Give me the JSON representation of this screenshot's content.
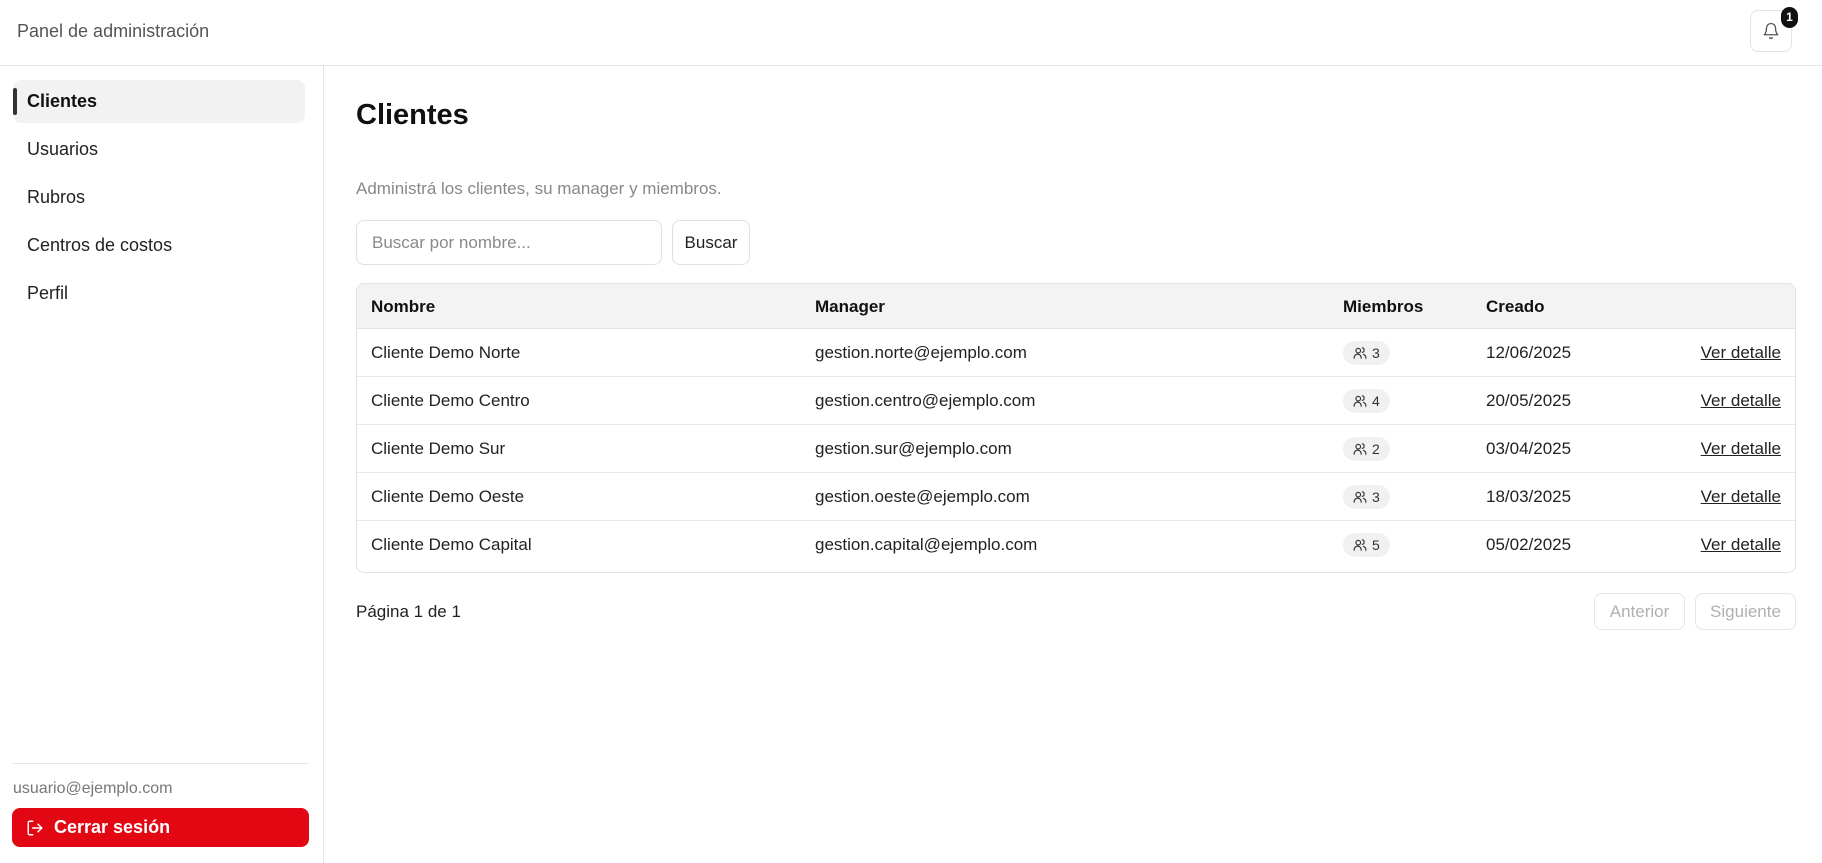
{
  "header": {
    "app_title": "Panel de administración",
    "notification_count": "1"
  },
  "sidebar": {
    "items": [
      {
        "label": "Clientes",
        "active": true
      },
      {
        "label": "Usuarios",
        "active": false
      },
      {
        "label": "Rubros",
        "active": false
      },
      {
        "label": "Centros de costos",
        "active": false
      },
      {
        "label": "Perfil",
        "active": false
      }
    ],
    "user_email": "usuario@ejemplo.com",
    "logout_label": "Cerrar sesión"
  },
  "main": {
    "title": "Clientes",
    "subtitle": "Administrá los clientes, su manager y miembros.",
    "search": {
      "placeholder": "Buscar por nombre...",
      "button_label": "Buscar"
    },
    "table": {
      "columns": [
        "Nombre",
        "Manager",
        "Miembros",
        "Creado"
      ],
      "rows": [
        {
          "nombre": "Cliente Demo Norte",
          "manager": "gestion.norte@ejemplo.com",
          "miembros": "3",
          "creado": "12/06/2025",
          "action": "Ver detalle"
        },
        {
          "nombre": "Cliente Demo Centro",
          "manager": "gestion.centro@ejemplo.com",
          "miembros": "4",
          "creado": "20/05/2025",
          "action": "Ver detalle"
        },
        {
          "nombre": "Cliente Demo Sur",
          "manager": "gestion.sur@ejemplo.com",
          "miembros": "2",
          "creado": "03/04/2025",
          "action": "Ver detalle"
        },
        {
          "nombre": "Cliente Demo Oeste",
          "manager": "gestion.oeste@ejemplo.com",
          "miembros": "3",
          "creado": "18/03/2025",
          "action": "Ver detalle"
        },
        {
          "nombre": "Cliente Demo Capital",
          "manager": "gestion.capital@ejemplo.com",
          "miembros": "5",
          "creado": "05/02/2025",
          "action": "Ver detalle"
        }
      ]
    },
    "pagination": {
      "text": "Página 1 de 1",
      "prev_label": "Anterior",
      "next_label": "Siguiente"
    }
  },
  "icons": {
    "notifications": "bell-icon",
    "members": "users-icon",
    "logout": "logout-icon"
  },
  "colors": {
    "logout_button": "#e30613",
    "active_nav_bg": "#f2f2f2",
    "table_header_bg": "#f3f3f3"
  }
}
